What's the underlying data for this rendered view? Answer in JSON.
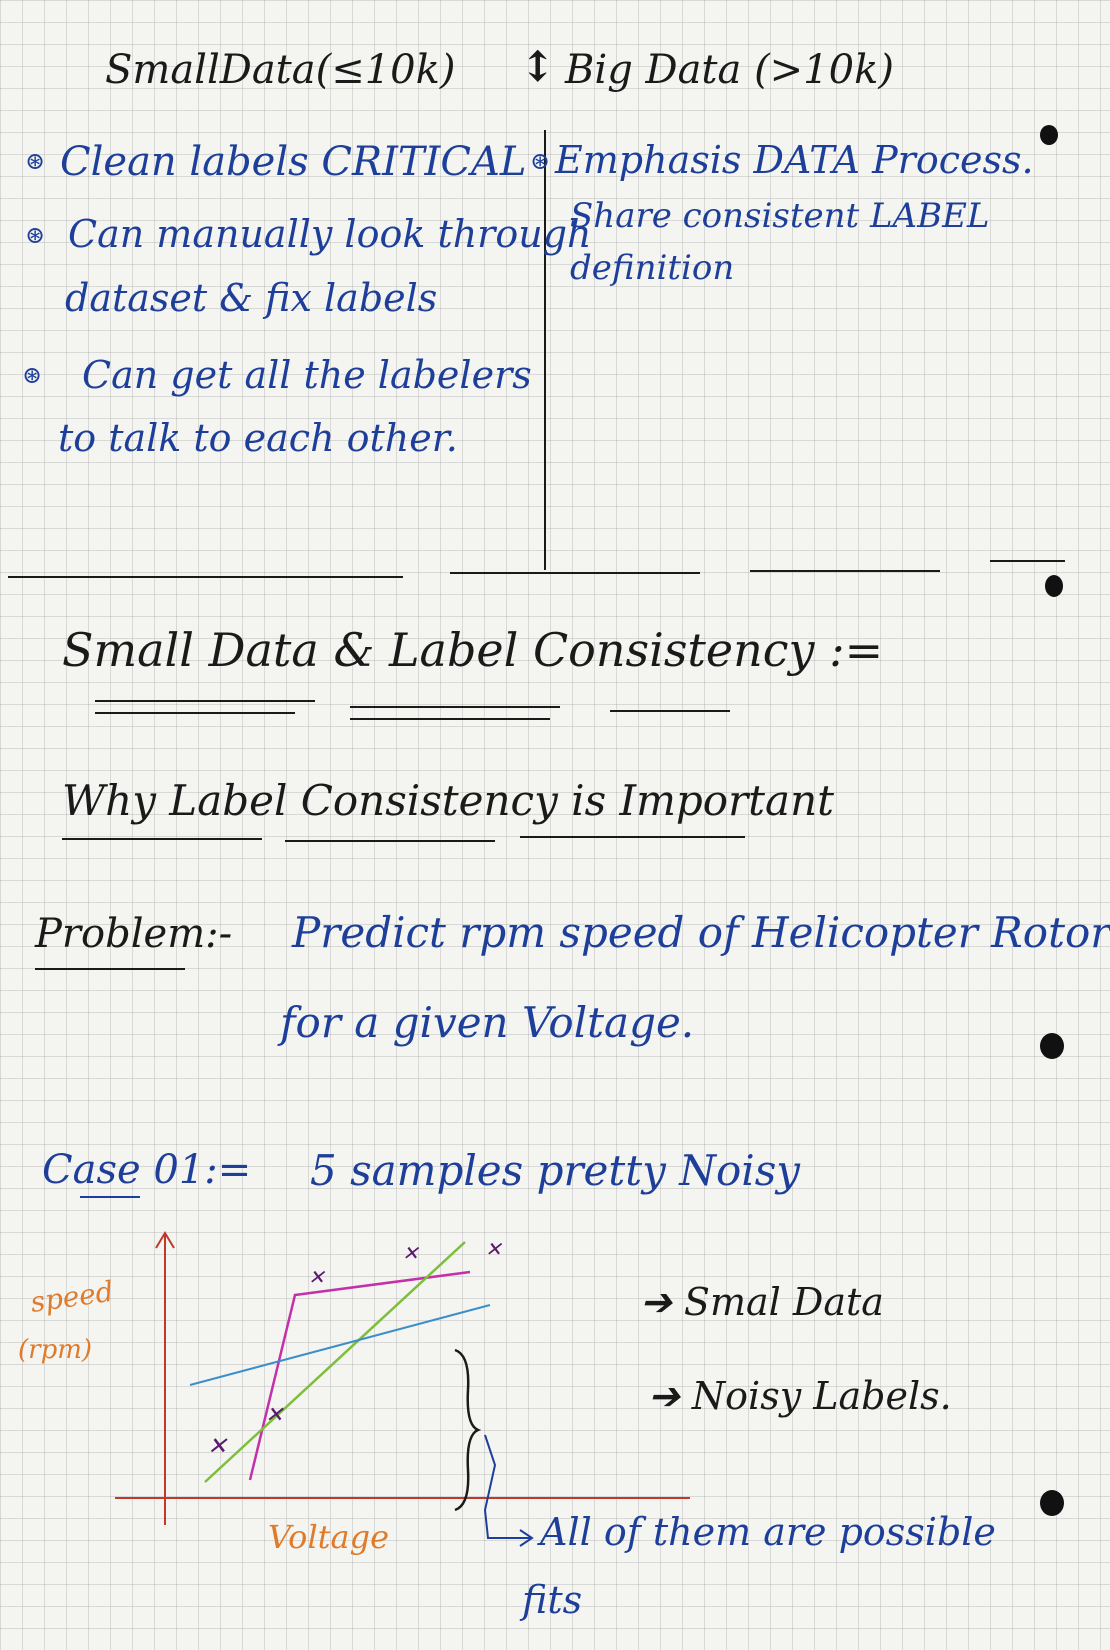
{
  "header": {
    "small_data": "SmallData(≤10k)",
    "arrow": "↕",
    "big_data": "Big Data (>10k)"
  },
  "small_data_points": [
    "Clean labels CRITICAL",
    "Can manually look through",
    "dataset & fix labels",
    "Can get all the labelers",
    "to talk to each other."
  ],
  "big_data_points": [
    "Emphasis DATA Process.",
    "Share consistent LABEL",
    "definition"
  ],
  "section": {
    "title": "Small Data & Label Consistency :=",
    "subtitle": "Why Label Consistency is Important"
  },
  "problem": {
    "label": "Problem:-",
    "line1": "Predict rpm speed of Helicopter Rotor",
    "line2": "for a given Voltage."
  },
  "case": {
    "label": "Case 01:=",
    "text": "5 samples pretty Noisy"
  },
  "chart_data": {
    "type": "scatter",
    "xlabel": "Voltage",
    "ylabel_line1": "speed",
    "ylabel_line2": "(rpm)",
    "points_count": 5
  },
  "notes": {
    "small_data": "➔ Smal Data",
    "noisy_labels": "➔ Noisy Labels.",
    "conclusion_line1": "All of them are possible",
    "conclusion_line2": "fits"
  },
  "colors": {
    "ink_black": "#1a1a1a",
    "ink_blue": "#1d3f9a",
    "axis_y": "#c0392b",
    "axis_label": "#e07b2a",
    "fit_pink": "#c330a8",
    "fit_green": "#7dbf3a",
    "fit_blue": "#3a8fc9",
    "marker": "#5a1a6e"
  }
}
